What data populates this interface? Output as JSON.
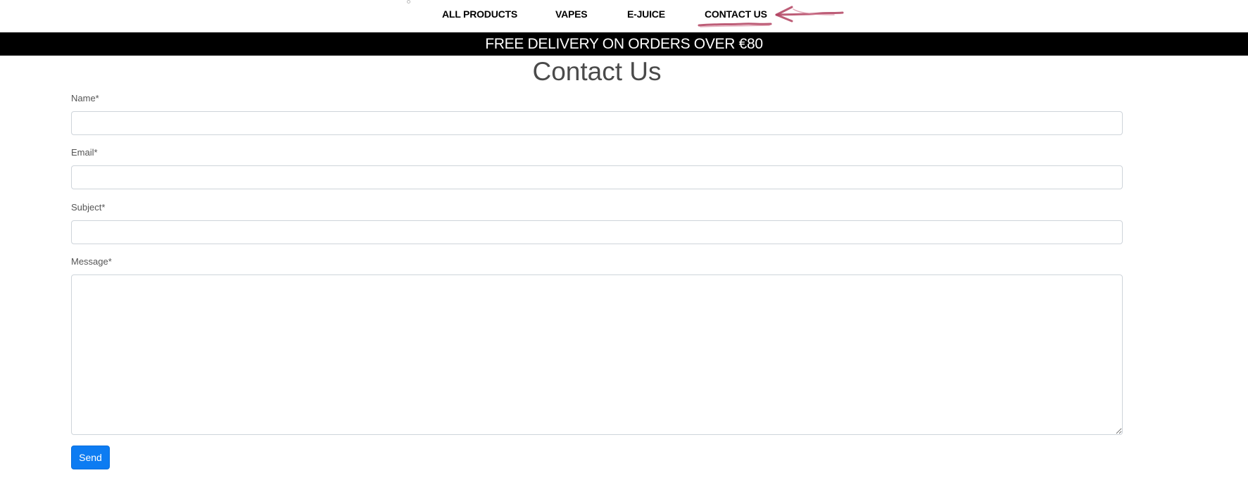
{
  "nav": {
    "items": [
      {
        "label": "ALL PRODUCTS"
      },
      {
        "label": "VAPES"
      },
      {
        "label": "E-JUICE"
      },
      {
        "label": "CONTACT US"
      }
    ]
  },
  "banner": {
    "text": "FREE DELIVERY ON ORDERS OVER €80",
    "background": "#000000",
    "color": "#ffffff"
  },
  "page": {
    "title": "Contact Us"
  },
  "form": {
    "name_label": "Name*",
    "name_value": "",
    "email_label": "Email*",
    "email_value": "",
    "subject_label": "Subject*",
    "subject_value": "",
    "message_label": "Message*",
    "message_value": "",
    "send_label": "Send",
    "send_color": "#0d7cf2"
  },
  "annotation": {
    "color": "#b2415f",
    "icon": "hand-drawn-arrow-icon"
  }
}
